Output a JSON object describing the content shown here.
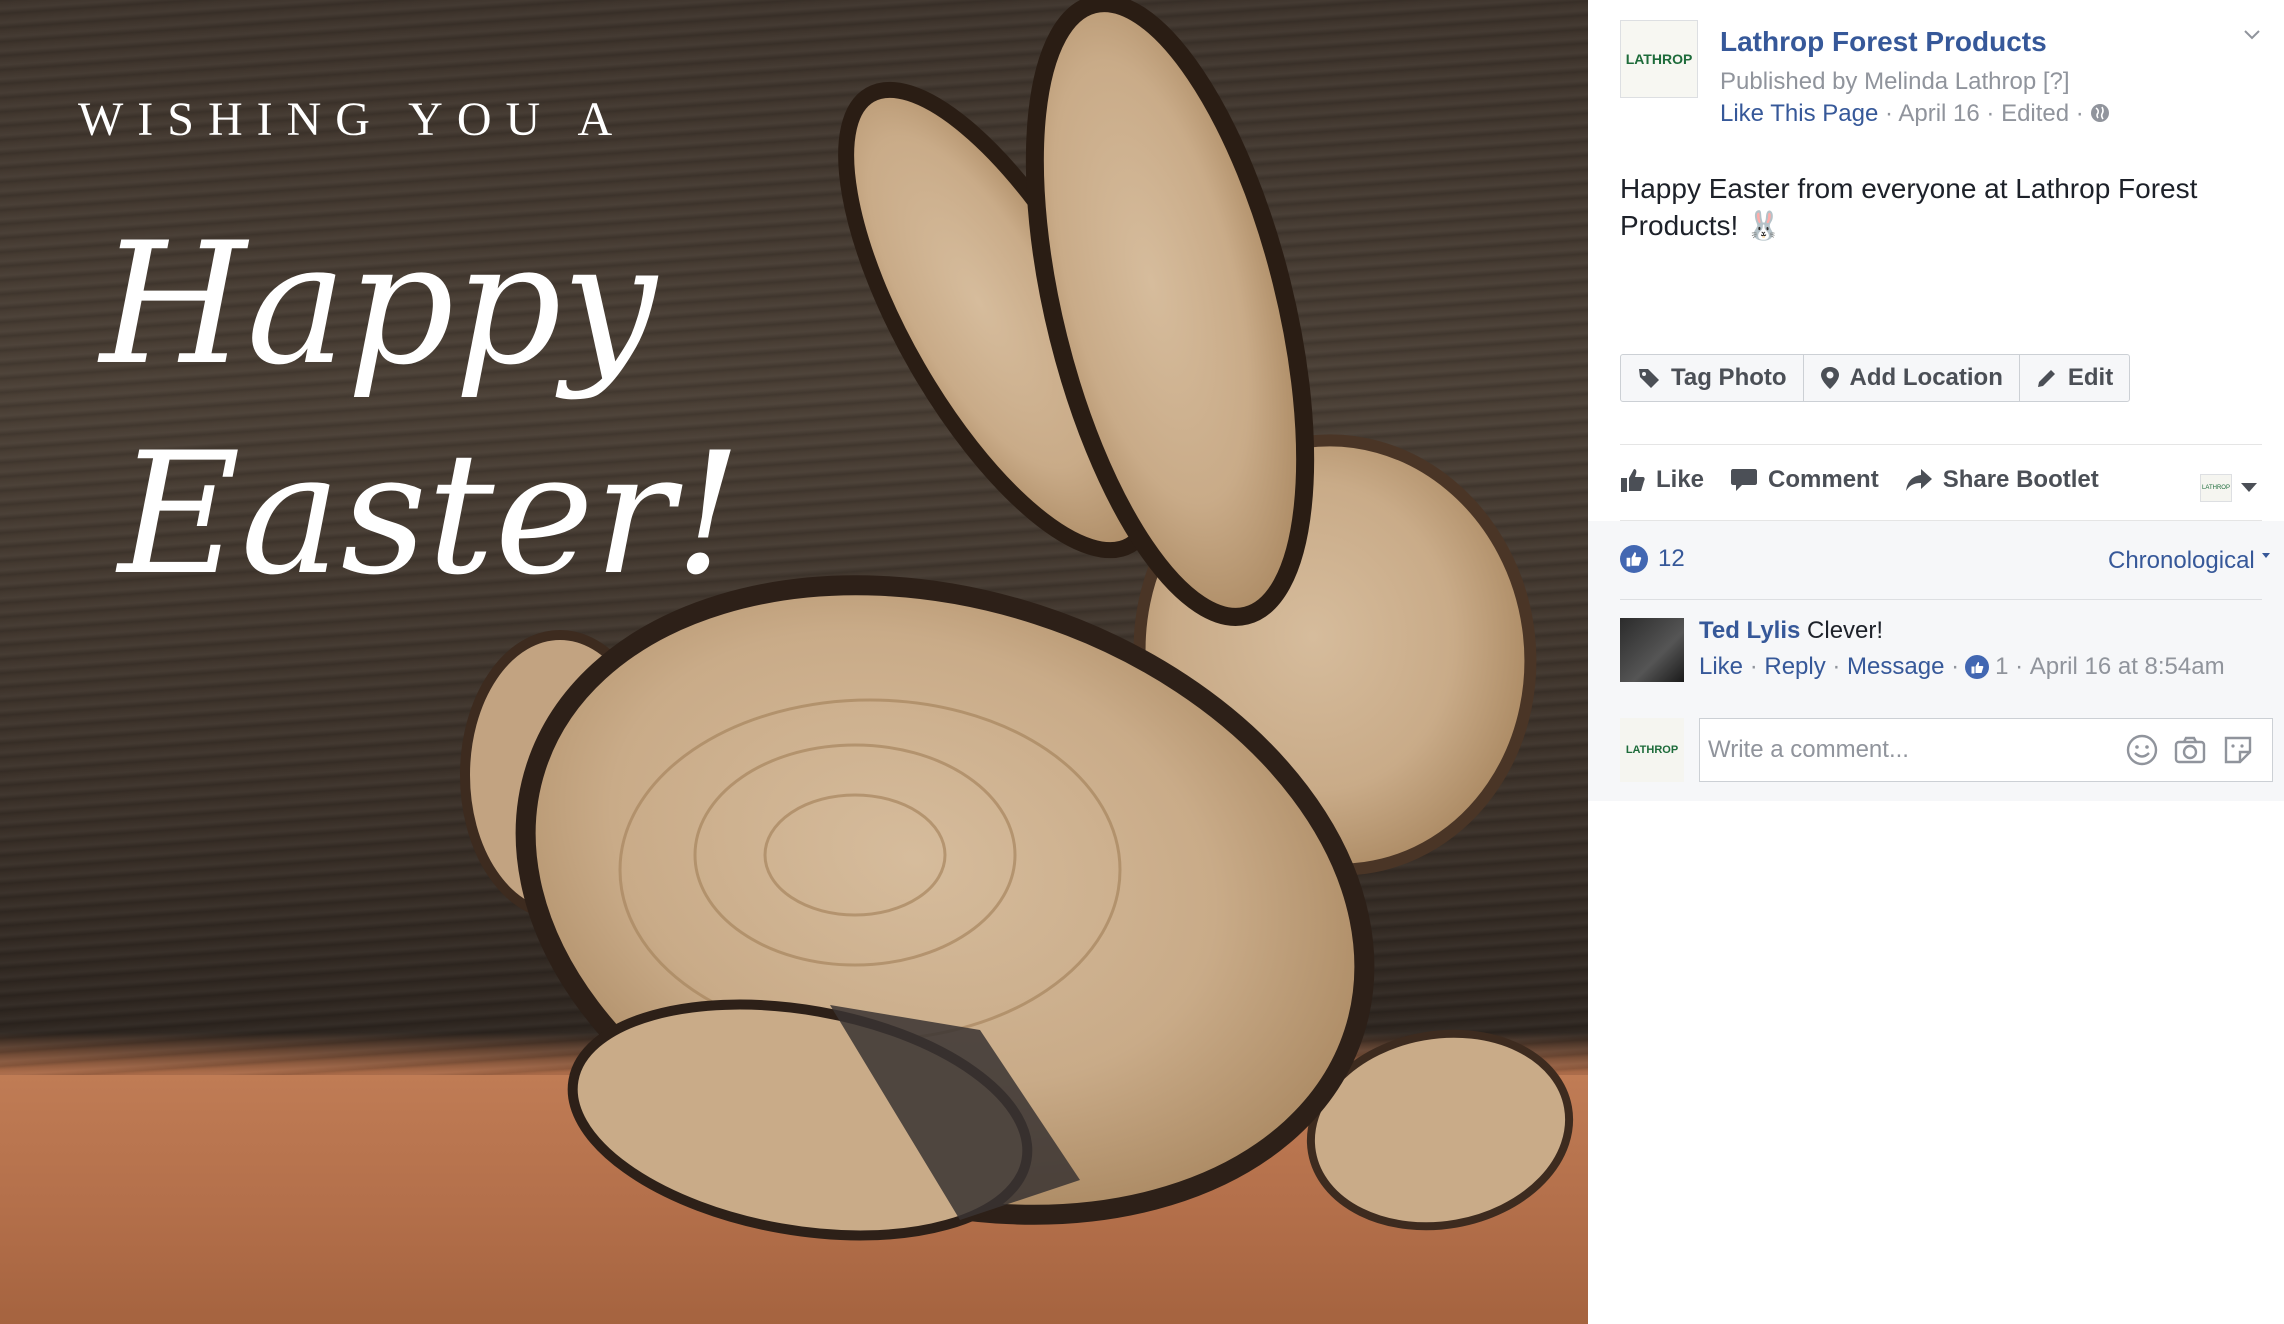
{
  "photo": {
    "line1": "WISHING YOU A",
    "line2": "Happy",
    "line3": "Easter!"
  },
  "post": {
    "page_name": "Lathrop Forest Products",
    "page_logo_text": "LATHROP",
    "published_by": "Published by Melinda Lathrop",
    "published_help": "[?]",
    "like_page": "Like This Page",
    "date": "April 16",
    "edited": "Edited",
    "text_line1": "Happy Easter from everyone at Lathrop Forest",
    "text_line2": "Products!",
    "emoji": "🐰"
  },
  "toolbar": {
    "tag_photo": "Tag Photo",
    "add_location": "Add Location",
    "edit": "Edit"
  },
  "actions": {
    "like": "Like",
    "comment": "Comment",
    "share": "Share Bootlet"
  },
  "reactions": {
    "count": "12",
    "order": "Chronological"
  },
  "comment": {
    "author": "Ted Lylis",
    "text": "Clever!",
    "like": "Like",
    "reply": "Reply",
    "message": "Message",
    "like_count": "1",
    "timestamp": "April 16 at 8:54am"
  },
  "composer": {
    "placeholder": "Write a comment...",
    "avatar_text": "LATHROP"
  },
  "colors": {
    "link": "#365899",
    "meta": "#90949c",
    "like_blue": "#4267b2"
  }
}
